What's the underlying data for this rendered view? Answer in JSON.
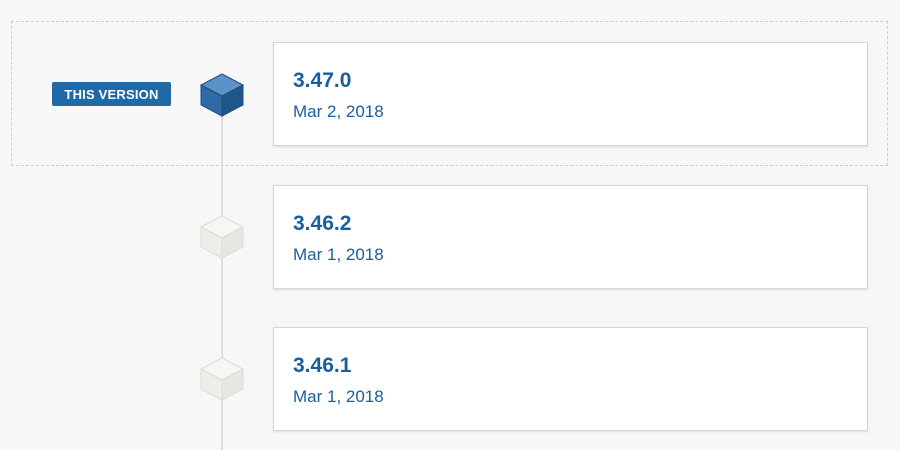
{
  "badge": {
    "label": "THIS VERSION"
  },
  "colors": {
    "accent": "#1f6aa6",
    "link_text": "#1a5e9c",
    "cube_active": "#2d6aa3",
    "cube_inactive": "#efefea",
    "background": "#f7f7f7"
  },
  "versions": [
    {
      "version": "3.47.0",
      "date": "Mar 2, 2018",
      "current": true,
      "icon": "cube-icon"
    },
    {
      "version": "3.46.2",
      "date": "Mar 1, 2018",
      "current": false,
      "icon": "cube-icon"
    },
    {
      "version": "3.46.1",
      "date": "Mar 1, 2018",
      "current": false,
      "icon": "cube-icon"
    }
  ]
}
